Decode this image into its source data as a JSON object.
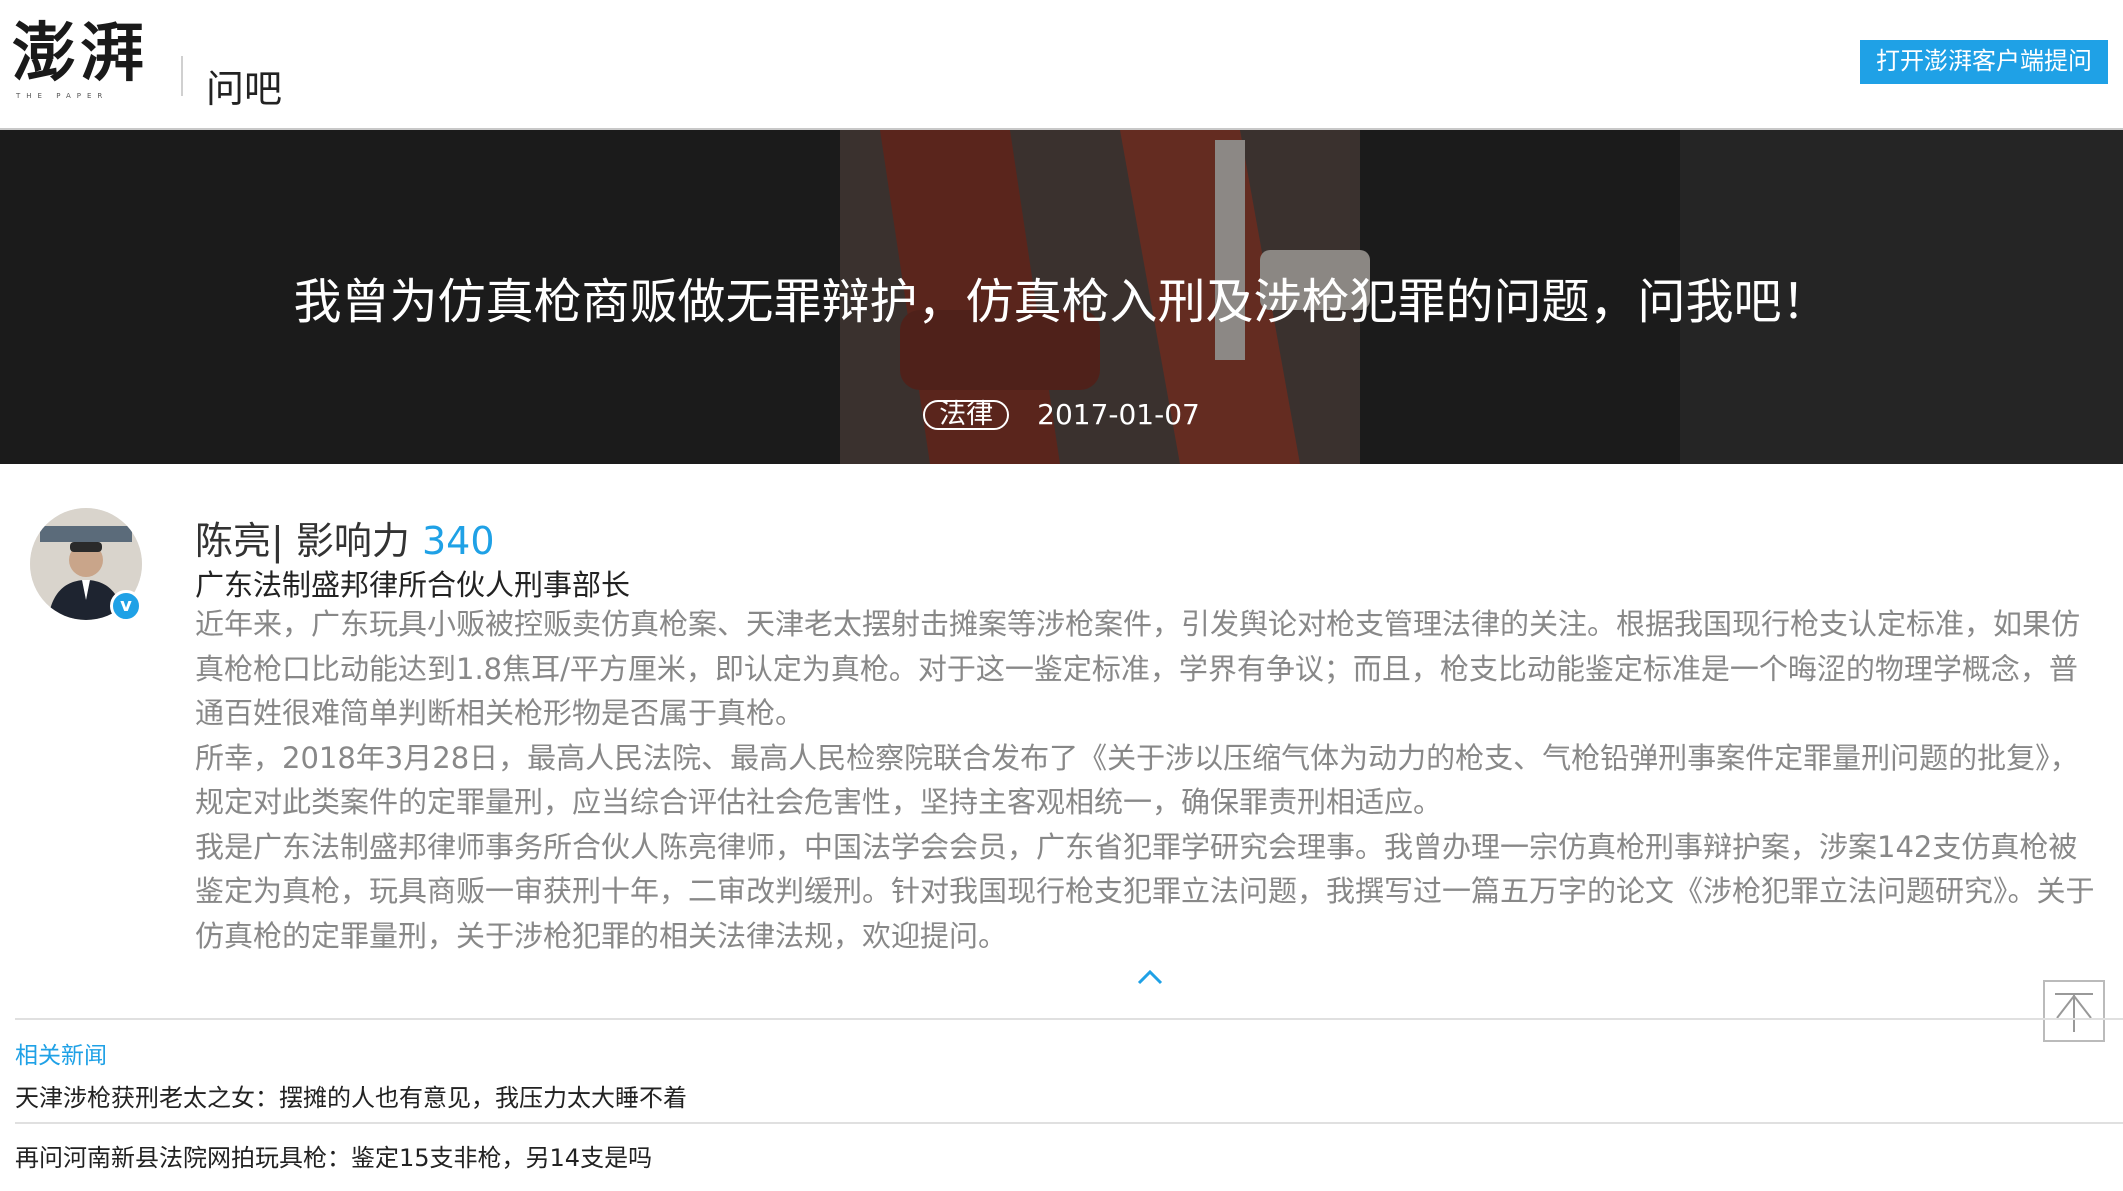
{
  "header": {
    "logo_text": "澎湃",
    "logo_sub": "THE PAPER",
    "section_name": "问吧",
    "open_app_label": "打开澎湃客户端提问"
  },
  "banner": {
    "title": "我曾为仿真枪商贩做无罪辩护，仿真枪入刑及涉枪犯罪的问题，问我吧！",
    "tag": "法律",
    "date": "2017-01-07"
  },
  "profile": {
    "name": "陈亮",
    "influence_label": "| 影响力",
    "influence_value": "340",
    "title": "广东法制盛邦律所合伙人刑事部长",
    "intro": [
      "近年来，广东玩具小贩被控贩卖仿真枪案、天津老太摆射击摊案等涉枪案件，引发舆论对枪支管理法律的关注。根据我国现行枪支认定标准，如果仿真枪枪口比动能达到1.8焦耳/平方厘米，即认定为真枪。对于这一鉴定标准，学界有争议；而且，枪支比动能鉴定标准是一个晦涩的物理学概念，普通百姓很难简单判断相关枪形物是否属于真枪。",
      "所幸，2018年3月28日，最高人民法院、最高人民检察院联合发布了《关于涉以压缩气体为动力的枪支、气枪铅弹刑事案件定罪量刑问题的批复》，规定对此类案件的定罪量刑，应当综合评估社会危害性，坚持主客观相统一，确保罪责刑相适应。",
      "我是广东法制盛邦律师事务所合伙人陈亮律师，中国法学会会员，广东省犯罪学研究会理事。我曾办理一宗仿真枪刑事辩护案，涉案142支仿真枪被鉴定为真枪，玩具商贩一审获刑十年，二审改判缓刑。针对我国现行枪支犯罪立法问题，我撰写过一篇五万字的论文《涉枪犯罪立法问题研究》。关于仿真枪的定罪量刑，关于涉枪犯罪的相关法律法规，欢迎提问。"
    ],
    "verified_mark": "v"
  },
  "related": {
    "heading": "相关新闻",
    "items": [
      "天津涉枪获刑老太之女：摆摊的人也有意见，我压力太大睡不着",
      "再问河南新县法院网拍玩具枪：鉴定15支非枪，另14支是吗"
    ]
  },
  "colors": {
    "accent": "#1fa1e6",
    "intro_text": "#888888",
    "banner_bg": "#2b2b2b"
  }
}
